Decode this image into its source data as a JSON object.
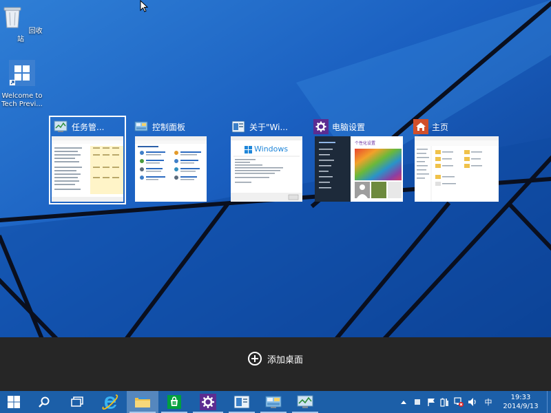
{
  "desktop": {
    "icons": [
      {
        "label": "回收站"
      },
      {
        "label": "Welcome to Tech Previ..."
      }
    ]
  },
  "task_view": {
    "windows": [
      {
        "title": "任务管...",
        "icon": "task-manager-icon",
        "selected": true
      },
      {
        "title": "控制面板",
        "icon": "control-panel-icon",
        "selected": false
      },
      {
        "title": "关于\"Wi...",
        "icon": "winver-icon",
        "selected": false
      },
      {
        "title": "电脑设置",
        "icon": "gear-icon",
        "selected": false
      },
      {
        "title": "主页",
        "icon": "home-icon",
        "selected": false
      }
    ],
    "thumb_text": {
      "winver_logo": "Windows",
      "settings_heading": "个性化设置"
    },
    "add_desktop_label": "添加桌面"
  },
  "taskbar": {
    "buttons": [
      {
        "name": "start-button",
        "icon": "windows-logo-icon"
      },
      {
        "name": "search-button",
        "icon": "search-icon"
      },
      {
        "name": "task-view-button",
        "icon": "task-view-icon"
      },
      {
        "name": "internet-explorer-button",
        "icon": "ie-icon"
      },
      {
        "name": "file-explorer-button",
        "icon": "folder-icon"
      },
      {
        "name": "store-button",
        "icon": "store-icon"
      },
      {
        "name": "pc-settings-button",
        "icon": "gear-icon"
      },
      {
        "name": "winver-button",
        "icon": "winver-icon"
      },
      {
        "name": "control-panel-button",
        "icon": "control-panel-icon"
      },
      {
        "name": "task-manager-button",
        "icon": "task-manager-icon"
      }
    ],
    "tray": {
      "ime": "中",
      "time": "19:33",
      "date": "2014/9/13"
    }
  },
  "colors": {
    "wallpaper": "#0d3f8f",
    "taskbar": "#1c5fa8",
    "add_bar": "#262626",
    "accent": "#ffffff"
  }
}
